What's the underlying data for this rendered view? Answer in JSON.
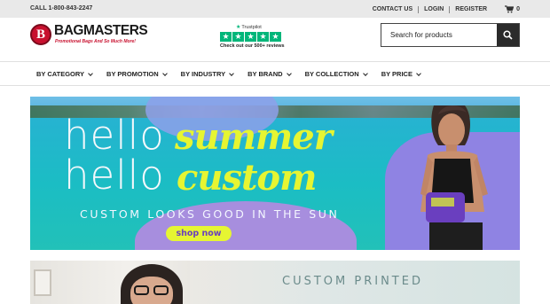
{
  "topbar": {
    "phone": "CALL 1-800-843-2247",
    "contact": "CONTACT US",
    "login": "LOGIN",
    "register": "REGISTER",
    "cart_count": "0"
  },
  "header": {
    "logo_mark": "B",
    "logo_name": "BAGMASTERS",
    "logo_tagline": "Promotional Bags And So Much More!",
    "trustpilot_name": "Trustpilot",
    "trustpilot_text": "Check out our 500+ reviews",
    "search_placeholder": "Search for products"
  },
  "nav": {
    "items": [
      {
        "label": "BY CATEGORY"
      },
      {
        "label": "BY PROMOTION"
      },
      {
        "label": "BY INDUSTRY"
      },
      {
        "label": "BY BRAND"
      },
      {
        "label": "BY COLLECTION"
      },
      {
        "label": "BY PRICE"
      }
    ]
  },
  "hero": {
    "line1": "hello",
    "line2": "hello",
    "word1": "summer",
    "word2": "custom",
    "subtitle": "CUSTOM LOOKS GOOD IN THE SUN",
    "cta": "shop now"
  },
  "banner2": {
    "title": "CUSTOM PRINTED"
  },
  "colors": {
    "brand_red": "#c8102e",
    "trustpilot_green": "#00b67a",
    "hero_yellow": "#e6f532",
    "hero_purple": "#8f83e3"
  }
}
